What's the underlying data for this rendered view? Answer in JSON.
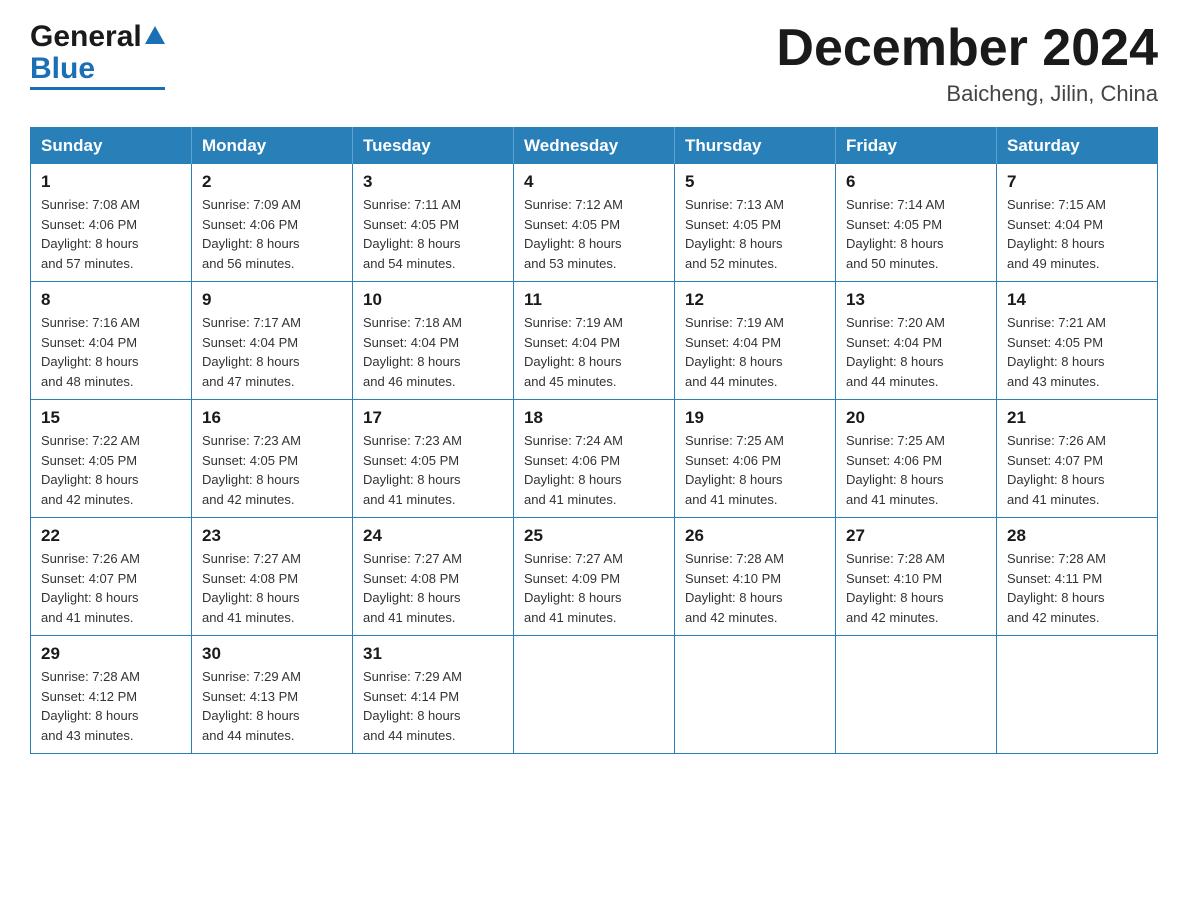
{
  "header": {
    "logo": {
      "general": "General",
      "blue": "Blue",
      "triangle": "▲"
    },
    "title": "December 2024",
    "location": "Baicheng, Jilin, China"
  },
  "weekdays": [
    "Sunday",
    "Monday",
    "Tuesday",
    "Wednesday",
    "Thursday",
    "Friday",
    "Saturday"
  ],
  "weeks": [
    [
      {
        "day": "1",
        "sunrise": "Sunrise: 7:08 AM",
        "sunset": "Sunset: 4:06 PM",
        "daylight": "Daylight: 8 hours",
        "daylight2": "and 57 minutes."
      },
      {
        "day": "2",
        "sunrise": "Sunrise: 7:09 AM",
        "sunset": "Sunset: 4:06 PM",
        "daylight": "Daylight: 8 hours",
        "daylight2": "and 56 minutes."
      },
      {
        "day": "3",
        "sunrise": "Sunrise: 7:11 AM",
        "sunset": "Sunset: 4:05 PM",
        "daylight": "Daylight: 8 hours",
        "daylight2": "and 54 minutes."
      },
      {
        "day": "4",
        "sunrise": "Sunrise: 7:12 AM",
        "sunset": "Sunset: 4:05 PM",
        "daylight": "Daylight: 8 hours",
        "daylight2": "and 53 minutes."
      },
      {
        "day": "5",
        "sunrise": "Sunrise: 7:13 AM",
        "sunset": "Sunset: 4:05 PM",
        "daylight": "Daylight: 8 hours",
        "daylight2": "and 52 minutes."
      },
      {
        "day": "6",
        "sunrise": "Sunrise: 7:14 AM",
        "sunset": "Sunset: 4:05 PM",
        "daylight": "Daylight: 8 hours",
        "daylight2": "and 50 minutes."
      },
      {
        "day": "7",
        "sunrise": "Sunrise: 7:15 AM",
        "sunset": "Sunset: 4:04 PM",
        "daylight": "Daylight: 8 hours",
        "daylight2": "and 49 minutes."
      }
    ],
    [
      {
        "day": "8",
        "sunrise": "Sunrise: 7:16 AM",
        "sunset": "Sunset: 4:04 PM",
        "daylight": "Daylight: 8 hours",
        "daylight2": "and 48 minutes."
      },
      {
        "day": "9",
        "sunrise": "Sunrise: 7:17 AM",
        "sunset": "Sunset: 4:04 PM",
        "daylight": "Daylight: 8 hours",
        "daylight2": "and 47 minutes."
      },
      {
        "day": "10",
        "sunrise": "Sunrise: 7:18 AM",
        "sunset": "Sunset: 4:04 PM",
        "daylight": "Daylight: 8 hours",
        "daylight2": "and 46 minutes."
      },
      {
        "day": "11",
        "sunrise": "Sunrise: 7:19 AM",
        "sunset": "Sunset: 4:04 PM",
        "daylight": "Daylight: 8 hours",
        "daylight2": "and 45 minutes."
      },
      {
        "day": "12",
        "sunrise": "Sunrise: 7:19 AM",
        "sunset": "Sunset: 4:04 PM",
        "daylight": "Daylight: 8 hours",
        "daylight2": "and 44 minutes."
      },
      {
        "day": "13",
        "sunrise": "Sunrise: 7:20 AM",
        "sunset": "Sunset: 4:04 PM",
        "daylight": "Daylight: 8 hours",
        "daylight2": "and 44 minutes."
      },
      {
        "day": "14",
        "sunrise": "Sunrise: 7:21 AM",
        "sunset": "Sunset: 4:05 PM",
        "daylight": "Daylight: 8 hours",
        "daylight2": "and 43 minutes."
      }
    ],
    [
      {
        "day": "15",
        "sunrise": "Sunrise: 7:22 AM",
        "sunset": "Sunset: 4:05 PM",
        "daylight": "Daylight: 8 hours",
        "daylight2": "and 42 minutes."
      },
      {
        "day": "16",
        "sunrise": "Sunrise: 7:23 AM",
        "sunset": "Sunset: 4:05 PM",
        "daylight": "Daylight: 8 hours",
        "daylight2": "and 42 minutes."
      },
      {
        "day": "17",
        "sunrise": "Sunrise: 7:23 AM",
        "sunset": "Sunset: 4:05 PM",
        "daylight": "Daylight: 8 hours",
        "daylight2": "and 41 minutes."
      },
      {
        "day": "18",
        "sunrise": "Sunrise: 7:24 AM",
        "sunset": "Sunset: 4:06 PM",
        "daylight": "Daylight: 8 hours",
        "daylight2": "and 41 minutes."
      },
      {
        "day": "19",
        "sunrise": "Sunrise: 7:25 AM",
        "sunset": "Sunset: 4:06 PM",
        "daylight": "Daylight: 8 hours",
        "daylight2": "and 41 minutes."
      },
      {
        "day": "20",
        "sunrise": "Sunrise: 7:25 AM",
        "sunset": "Sunset: 4:06 PM",
        "daylight": "Daylight: 8 hours",
        "daylight2": "and 41 minutes."
      },
      {
        "day": "21",
        "sunrise": "Sunrise: 7:26 AM",
        "sunset": "Sunset: 4:07 PM",
        "daylight": "Daylight: 8 hours",
        "daylight2": "and 41 minutes."
      }
    ],
    [
      {
        "day": "22",
        "sunrise": "Sunrise: 7:26 AM",
        "sunset": "Sunset: 4:07 PM",
        "daylight": "Daylight: 8 hours",
        "daylight2": "and 41 minutes."
      },
      {
        "day": "23",
        "sunrise": "Sunrise: 7:27 AM",
        "sunset": "Sunset: 4:08 PM",
        "daylight": "Daylight: 8 hours",
        "daylight2": "and 41 minutes."
      },
      {
        "day": "24",
        "sunrise": "Sunrise: 7:27 AM",
        "sunset": "Sunset: 4:08 PM",
        "daylight": "Daylight: 8 hours",
        "daylight2": "and 41 minutes."
      },
      {
        "day": "25",
        "sunrise": "Sunrise: 7:27 AM",
        "sunset": "Sunset: 4:09 PM",
        "daylight": "Daylight: 8 hours",
        "daylight2": "and 41 minutes."
      },
      {
        "day": "26",
        "sunrise": "Sunrise: 7:28 AM",
        "sunset": "Sunset: 4:10 PM",
        "daylight": "Daylight: 8 hours",
        "daylight2": "and 42 minutes."
      },
      {
        "day": "27",
        "sunrise": "Sunrise: 7:28 AM",
        "sunset": "Sunset: 4:10 PM",
        "daylight": "Daylight: 8 hours",
        "daylight2": "and 42 minutes."
      },
      {
        "day": "28",
        "sunrise": "Sunrise: 7:28 AM",
        "sunset": "Sunset: 4:11 PM",
        "daylight": "Daylight: 8 hours",
        "daylight2": "and 42 minutes."
      }
    ],
    [
      {
        "day": "29",
        "sunrise": "Sunrise: 7:28 AM",
        "sunset": "Sunset: 4:12 PM",
        "daylight": "Daylight: 8 hours",
        "daylight2": "and 43 minutes."
      },
      {
        "day": "30",
        "sunrise": "Sunrise: 7:29 AM",
        "sunset": "Sunset: 4:13 PM",
        "daylight": "Daylight: 8 hours",
        "daylight2": "and 44 minutes."
      },
      {
        "day": "31",
        "sunrise": "Sunrise: 7:29 AM",
        "sunset": "Sunset: 4:14 PM",
        "daylight": "Daylight: 8 hours",
        "daylight2": "and 44 minutes."
      },
      null,
      null,
      null,
      null
    ]
  ]
}
